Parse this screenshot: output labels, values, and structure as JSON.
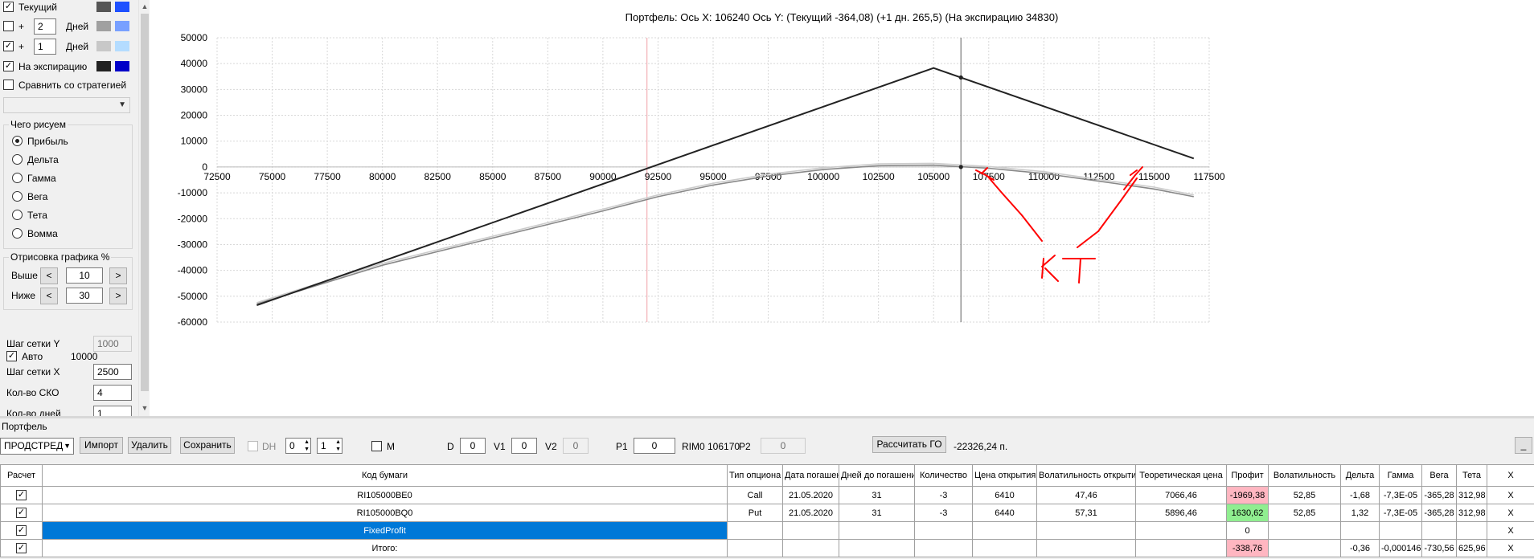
{
  "left": {
    "series": [
      {
        "checked": "✓",
        "label": "Текущий",
        "colors": [
          "#555555",
          "#1e50ff"
        ]
      },
      {
        "checked": "",
        "plus": "+",
        "days": "2",
        "days_label": "Дней",
        "colors": [
          "#a0a0a0",
          "#78a0ff"
        ]
      },
      {
        "checked": "✓",
        "plus": "+",
        "days": "1",
        "days_label": "Дней",
        "colors": [
          "#c8c8c8",
          "#b4dcff"
        ]
      },
      {
        "checked": "✓",
        "label": "На экспирацию",
        "colors": [
          "#222222",
          "#0000c8"
        ]
      }
    ],
    "compare_label": "Сравнить со стратегией",
    "compare_dropdown": "",
    "draw_group": {
      "title": "Чего рисуем",
      "options": [
        "Прибыль",
        "Дельта",
        "Гамма",
        "Вега",
        "Тета",
        "Вомма"
      ],
      "selected": "Прибыль"
    },
    "render_group": {
      "title": "Отрисовка графика %",
      "above_label": "Выше",
      "above_value": "10",
      "below_label": "Ниже",
      "below_value": "30",
      "left_arrow": "<",
      "right_arrow": ">"
    },
    "grid_y_label": "Шаг сетки Y",
    "grid_y_value": "1000",
    "auto_label": "Авто",
    "auto_checked": "✓",
    "auto_value": "10000",
    "grid_x_label": "Шаг сетки X",
    "grid_x_value": "2500",
    "sko_label": "Кол-во СКО",
    "sko_value": "4",
    "days_count_label": "Кол-во дней",
    "days_count_value": "1"
  },
  "chart_title": "Портфель: Ось X: 106240 Ось Y:  (Текущий -364,08)  (+1 дн. 265,5)  (На экспирацию 34830)",
  "chart_data": {
    "type": "line",
    "xlim": [
      72500,
      117500
    ],
    "ylim": [
      -60000,
      50000
    ],
    "x_ticks": [
      "72500",
      "75000",
      "77500",
      "80000",
      "82500",
      "85000",
      "87500",
      "90000",
      "92500",
      "95000",
      "97500",
      "100000",
      "102500",
      "105000",
      "107500",
      "110000",
      "112500",
      "115000",
      "117500"
    ],
    "y_ticks": [
      "50000",
      "40000",
      "30000",
      "20000",
      "10000",
      "0",
      "-10000",
      "-20000",
      "-30000",
      "-40000",
      "-50000",
      "-60000"
    ],
    "cursor_x": 106240,
    "ref_line_x": 92000,
    "series": [
      {
        "color": "#222222",
        "x": [
          74300,
          105000,
          116800
        ],
        "y": [
          -53500,
          38300,
          3300
        ]
      },
      {
        "color": "#888888",
        "x": [
          74300,
          80000,
          85000,
          90000,
          92500,
          95000,
          97500,
          100000,
          102500,
          105000,
          107500,
          110000,
          112500,
          115000,
          116800
        ],
        "y": [
          -53000,
          -38000,
          -27500,
          -17000,
          -11500,
          -7000,
          -3500,
          -1000,
          500,
          700,
          -500,
          -2500,
          -5500,
          -8500,
          -11500
        ]
      },
      {
        "color": "#cccccc",
        "x": [
          74300,
          80000,
          85000,
          90000,
          92500,
          95000,
          97500,
          100000,
          102500,
          105000,
          107500,
          110000,
          112500,
          115000,
          116800
        ],
        "y": [
          -52500,
          -37300,
          -26800,
          -16300,
          -10800,
          -6300,
          -2800,
          -300,
          1200,
          1400,
          200,
          -1800,
          -4800,
          -7800,
          -10800
        ]
      }
    ],
    "annotation": "КТ"
  },
  "portfolio": {
    "label": "Портфель",
    "strategy": "ПРОДСТРЕД",
    "buttons": {
      "import": "Импорт",
      "delete": "Удалить",
      "save": "Сохранить",
      "calc_go": "Рассчитать ГО",
      "min": "_"
    },
    "dh_label": "DH",
    "spin1": "0",
    "spin2": "1",
    "m_label": "M",
    "d_label": "D",
    "d_value": "0",
    "v1_label": "V1",
    "v1_value": "0",
    "v2_label": "V2",
    "v2_value": "0",
    "p1_label": "P1",
    "p1_value": "0",
    "rim_label": "RIM0 106170",
    "p2_label": "P2",
    "p2_value": "0",
    "go_value": "-22326,24 п."
  },
  "table": {
    "headers": [
      "Расчет",
      "Код бумаги",
      "Тип опциона",
      "Дата погашения",
      "Дней до погашения",
      "Количество",
      "Цена открытия",
      "Волатильность открытия",
      "Теоретическая цена",
      "Профит",
      "Волатильность",
      "Дельта",
      "Гамма",
      "Вега",
      "Тета",
      "X"
    ],
    "rows": [
      {
        "check": "✓",
        "code": "RI105000BE0",
        "type": "Call",
        "date": "21.05.2020",
        "days": "31",
        "qty": "-3",
        "price": "6410",
        "vol_open": "47,46",
        "theo": "7066,46",
        "profit": "-1969,38",
        "vol": "52,85",
        "delta": "-1,68",
        "gamma": "-7,3E-05",
        "vega": "-365,28",
        "theta": "312,98",
        "x": "X",
        "profit_class": "cell-red",
        "code_class": ""
      },
      {
        "check": "✓",
        "code": "RI105000BQ0",
        "type": "Put",
        "date": "21.05.2020",
        "days": "31",
        "qty": "-3",
        "price": "6440",
        "vol_open": "57,31",
        "theo": "5896,46",
        "profit": "1630,62",
        "vol": "52,85",
        "delta": "1,32",
        "gamma": "-7,3E-05",
        "vega": "-365,28",
        "theta": "312,98",
        "x": "X",
        "profit_class": "cell-green",
        "code_class": ""
      },
      {
        "check": "✓",
        "code": "FixedProfit",
        "type": "",
        "date": "",
        "days": "",
        "qty": "",
        "price": "",
        "vol_open": "",
        "theo": "",
        "profit": "0",
        "vol": "",
        "delta": "",
        "gamma": "",
        "vega": "",
        "theta": "",
        "x": "X",
        "profit_class": "",
        "code_class": "cell-blue"
      },
      {
        "check": "✓",
        "code": "Итого:",
        "type": "",
        "date": "",
        "days": "",
        "qty": "",
        "price": "",
        "vol_open": "",
        "theo": "",
        "profit": "-338,76",
        "vol": "",
        "delta": "-0,36",
        "gamma": "-0,000146",
        "vega": "-730,56",
        "theta": "625,96",
        "x": "X",
        "profit_class": "cell-red",
        "code_class": ""
      }
    ]
  }
}
